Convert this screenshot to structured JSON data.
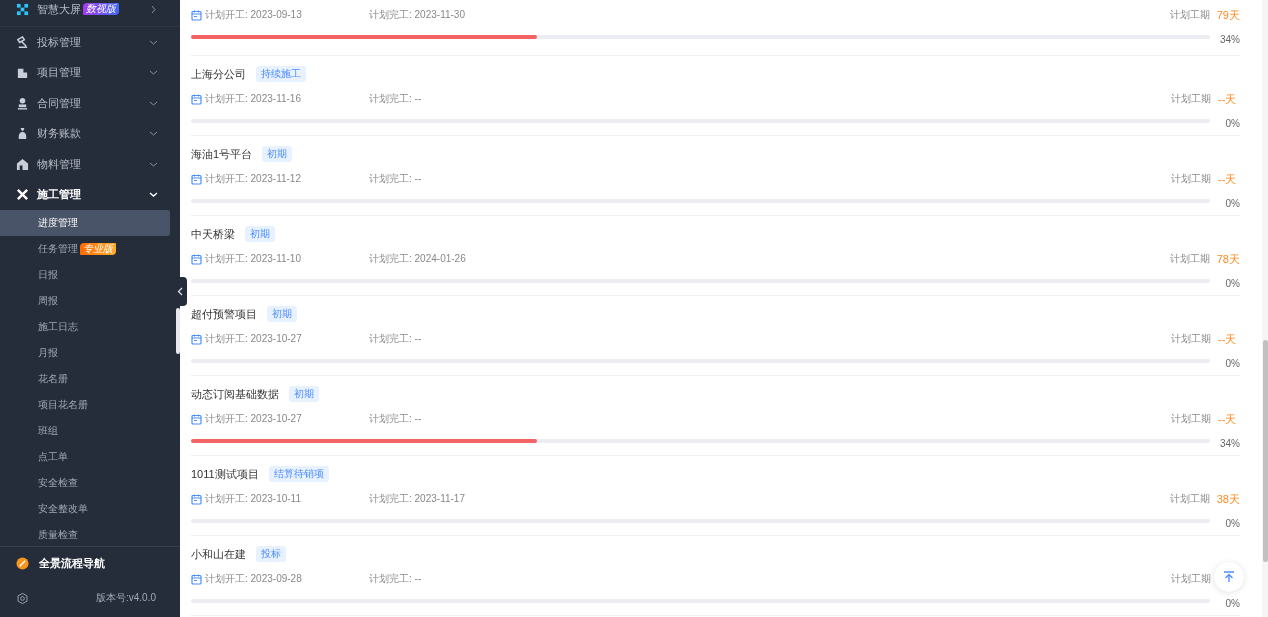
{
  "sidebar": {
    "menu": [
      {
        "kind": "link",
        "label": "智慧大屏",
        "badge": "数视版",
        "expanded": false
      },
      {
        "kind": "group",
        "label": "投标管理",
        "expanded": false
      },
      {
        "kind": "group",
        "label": "项目管理",
        "expanded": false
      },
      {
        "kind": "group",
        "label": "合同管理",
        "expanded": false
      },
      {
        "kind": "group",
        "label": "财务账款",
        "expanded": false
      },
      {
        "kind": "group",
        "label": "物料管理",
        "expanded": false
      },
      {
        "kind": "group",
        "label": "施工管理",
        "expanded": true,
        "children": [
          {
            "label": "进度管理",
            "selected": true
          },
          {
            "label": "任务管理",
            "badge": "专业版",
            "selected": false
          },
          {
            "label": "日报",
            "selected": false
          },
          {
            "label": "周报",
            "selected": false
          },
          {
            "label": "施工日志",
            "selected": false
          },
          {
            "label": "月报",
            "selected": false
          },
          {
            "label": "花名册",
            "selected": false
          },
          {
            "label": "项目花名册",
            "selected": false
          },
          {
            "label": "班组",
            "selected": false
          },
          {
            "label": "点工单",
            "selected": false
          },
          {
            "label": "安全检查",
            "selected": false
          },
          {
            "label": "安全整改单",
            "selected": false
          },
          {
            "label": "质量检查",
            "selected": false
          }
        ]
      }
    ],
    "nav_link": "全景流程导航",
    "version": "版本号:v4.0.0"
  },
  "projects": [
    {
      "start": "计划开工: 2023-09-13",
      "end": "计划完工: 2023-11-30",
      "duration_label": "计划工期",
      "duration": "79天",
      "level": 0.34,
      "percent": "34%"
    },
    {
      "name": "上海分公司",
      "tag": "持续施工",
      "start": "计划开工: 2023-11-16",
      "end": "计划完工: --",
      "duration_label": "计划工期",
      "duration": "--天",
      "percent": "0%"
    },
    {
      "name": "海油1号平台",
      "tag": "初期",
      "start": "计划开工: 2023-11-12",
      "end": "计划完工: --",
      "duration_label": "计划工期",
      "duration": "--天",
      "percent": "0%"
    },
    {
      "name": "中天桥梁",
      "tag": "初期",
      "start": "计划开工: 2023-11-10",
      "end": "计划完工: 2024-01-26",
      "duration_label": "计划工期",
      "duration": "78天",
      "percent": "0%"
    },
    {
      "name": "超付预警项目",
      "tag": "初期",
      "start": "计划开工: 2023-10-27",
      "end": "计划完工: --",
      "duration_label": "计划工期",
      "duration": "--天",
      "percent": "0%"
    },
    {
      "name": "动态订阅基础数据",
      "tag": "初期",
      "start": "计划开工: 2023-10-27",
      "end": "计划完工: --",
      "duration_label": "计划工期",
      "duration": "--天",
      "level": 0.34,
      "percent": "34%"
    },
    {
      "name": "1011测试项目",
      "tag": "结算待销项",
      "start": "计划开工: 2023-10-11",
      "end": "计划完工: 2023-11-17",
      "duration_label": "计划工期",
      "duration": "38天",
      "percent": "0%"
    },
    {
      "name": "小和山在建",
      "tag": "投标",
      "start": "计划开工: 2023-09-28",
      "end": "计划完工: --",
      "duration_label": "计划工期",
      "percent": "0%"
    }
  ]
}
